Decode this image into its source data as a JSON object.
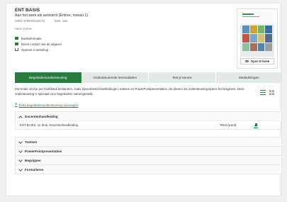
{
  "product": {
    "title": "ENT BASIS",
    "subtitle": "Aan het werk als assistent (Entree, niveau 1)",
    "isbn": "ISBN: 9789400226272",
    "edition": "Druk: 1ste",
    "series": "Serie: Entree"
  },
  "info_links": [
    {
      "label": "Boekinformatie",
      "icon": "book-icon"
    },
    {
      "label": "Direct contact met de uitgever",
      "icon": "mail-icon"
    },
    {
      "label": "Openen in webshop",
      "icon": "cart-icon"
    }
  ],
  "cover": {
    "open_button": "Open E-boek",
    "tile_colors": [
      "#5d8fb8",
      "#c9a43b",
      "#7bb36c",
      "#3e6e9e",
      "#b55a44",
      "#7aa6c2",
      "#d1c07a",
      "#556b8a",
      "#8cbf9a",
      "#a66f5e",
      "#4f86ad",
      "#9d9d9d"
    ]
  },
  "tabs": [
    {
      "label": "Begeleidersondersteuning",
      "active": true
    },
    {
      "label": "Ondersteunende leermiddelen",
      "active": false
    },
    {
      "label": "Test je kennis",
      "active": false
    },
    {
      "label": "Mededelingen",
      "active": false
    }
  ],
  "description": "Hieronder vind je per hoofdstuk bestanden, zoals bijvoorbeeld handleidingen, toetsen en PowerPointpresentaties, die dienen als ondersteuning tijdens het lesgeven. Deze ondersteuning is speciaal voor begeleiders samengesteld.",
  "extra_link": "Extra begeleidersondersteuning toevoegen",
  "sections": [
    {
      "label": "Docentenhandleiding",
      "expanded": true,
      "rows": [
        {
          "name": "ENT BASIS, 1e druk, Docentenhandleiding",
          "type": "Tekst (word)"
        }
      ]
    },
    {
      "label": "Toetsen",
      "expanded": false
    },
    {
      "label": "PowerPointpresentaties",
      "expanded": false
    },
    {
      "label": "Begrippen",
      "expanded": false
    },
    {
      "label": "Formulieren",
      "expanded": false
    }
  ],
  "colors": {
    "accent": "#2b7a3f",
    "tab_inactive": "#e3e9e5"
  }
}
